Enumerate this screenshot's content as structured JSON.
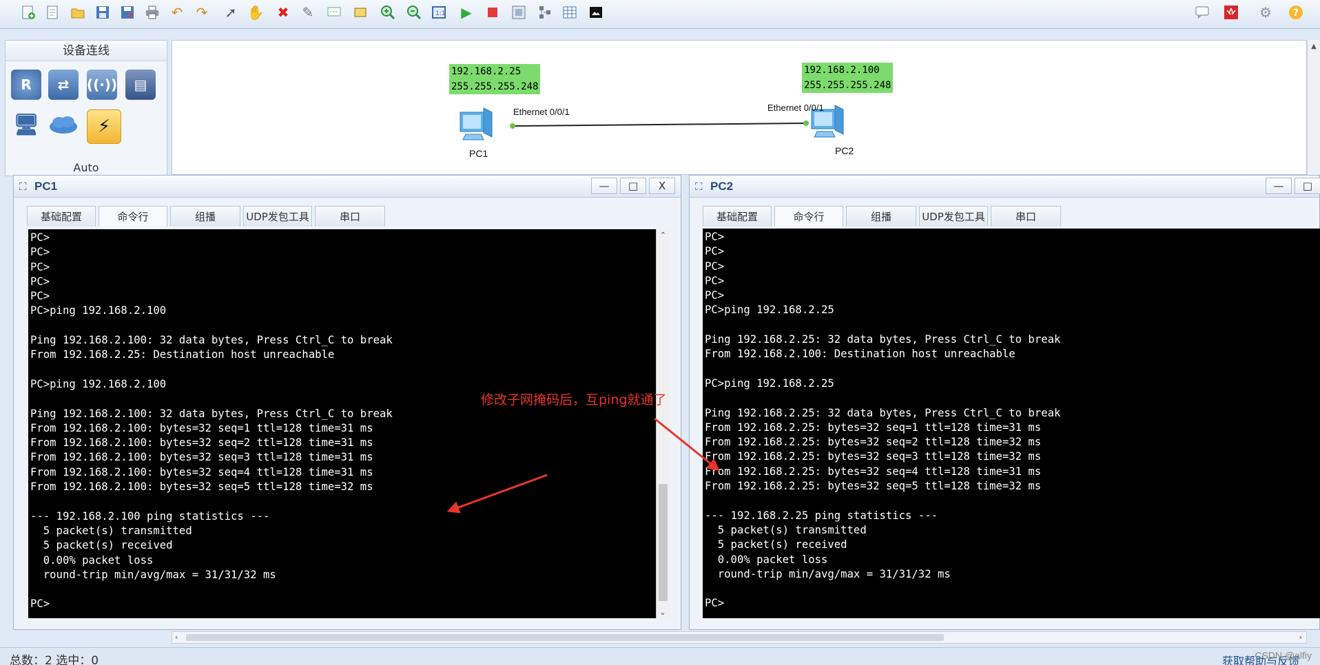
{
  "toolbar": {
    "icons": [
      "new-topology-icon",
      "new-file-icon",
      "open-icon",
      "save-icon",
      "save-as-icon",
      "print-icon",
      "undo-icon",
      "redo-icon",
      "select-icon",
      "hand-icon",
      "delete-icon",
      "delete-link-icon",
      "text-note-icon",
      "rectangle-icon",
      "zoom-in-icon",
      "zoom-out-icon",
      "fit-icon",
      "start-icon",
      "stop-icon",
      "capture-icon",
      "topology-icon",
      "table-icon",
      "screenshot-icon"
    ],
    "right_icons": [
      "chat-icon",
      "huawei-logo-icon",
      "settings-icon",
      "help-icon"
    ]
  },
  "left_panel": {
    "title": "设备连线",
    "auto_label": "Auto",
    "devices": [
      "router-icon",
      "switch-icon",
      "wireless-icon",
      "firewall-icon",
      "pc-icon",
      "cloud-icon",
      "cable-icon"
    ]
  },
  "topology": {
    "pc1": {
      "name": "PC1",
      "ip": "192.168.2.25",
      "mask": "255.255.255.248",
      "port": "Ethernet 0/0/1"
    },
    "pc2": {
      "name": "PC2",
      "ip": "192.168.2.100",
      "mask": "255.255.255.248",
      "port": "Ethernet 0/0/1"
    }
  },
  "pc1_window": {
    "title": "PC1",
    "buttons": {
      "minimize": "—",
      "maximize": "□",
      "close": "X"
    },
    "tabs": [
      "基础配置",
      "命令行",
      "组播",
      "UDP发包工具",
      "串口"
    ],
    "active_tab": "命令行",
    "lines": [
      "PC>",
      "PC>",
      "PC>",
      "PC>",
      "PC>",
      "PC>ping 192.168.2.100",
      "",
      "Ping 192.168.2.100: 32 data bytes, Press Ctrl_C to break",
      "From 192.168.2.25: Destination host unreachable",
      "",
      "PC>ping 192.168.2.100",
      "",
      "Ping 192.168.2.100: 32 data bytes, Press Ctrl_C to break",
      "From 192.168.2.100: bytes=32 seq=1 ttl=128 time=31 ms",
      "From 192.168.2.100: bytes=32 seq=2 ttl=128 time=31 ms",
      "From 192.168.2.100: bytes=32 seq=3 ttl=128 time=31 ms",
      "From 192.168.2.100: bytes=32 seq=4 ttl=128 time=31 ms",
      "From 192.168.2.100: bytes=32 seq=5 ttl=128 time=32 ms",
      "",
      "--- 192.168.2.100 ping statistics ---",
      "  5 packet(s) transmitted",
      "  5 packet(s) received",
      "  0.00% packet loss",
      "  round-trip min/avg/max = 31/31/32 ms",
      "",
      "PC>"
    ]
  },
  "pc2_window": {
    "title": "PC2",
    "buttons": {
      "minimize": "—",
      "maximize": "□"
    },
    "tabs": [
      "基础配置",
      "命令行",
      "组播",
      "UDP发包工具",
      "串口"
    ],
    "active_tab": "命令行",
    "lines": [
      "PC>",
      "PC>",
      "PC>",
      "PC>",
      "PC>",
      "PC>ping 192.168.2.25",
      "",
      "Ping 192.168.2.25: 32 data bytes, Press Ctrl_C to break",
      "From 192.168.2.100: Destination host unreachable",
      "",
      "PC>ping 192.168.2.25",
      "",
      "Ping 192.168.2.25: 32 data bytes, Press Ctrl_C to break",
      "From 192.168.2.25: bytes=32 seq=1 ttl=128 time=31 ms",
      "From 192.168.2.25: bytes=32 seq=2 ttl=128 time=32 ms",
      "From 192.168.2.25: bytes=32 seq=3 ttl=128 time=32 ms",
      "From 192.168.2.25: bytes=32 seq=4 ttl=128 time=31 ms",
      "From 192.168.2.25: bytes=32 seq=5 ttl=128 time=32 ms",
      "",
      "--- 192.168.2.25 ping statistics ---",
      "  5 packet(s) transmitted",
      "  5 packet(s) received",
      "  0.00% packet loss",
      "  round-trip min/avg/max = 31/31/32 ms",
      "",
      "PC>"
    ]
  },
  "annotation": {
    "text": "修改子网掩码后，互ping就通了",
    "color": "#e8352c"
  },
  "statusbar": {
    "left": "总数：2 选中：0",
    "right": "获取帮助与反馈",
    "watermark": "CSDN @alfiy"
  }
}
